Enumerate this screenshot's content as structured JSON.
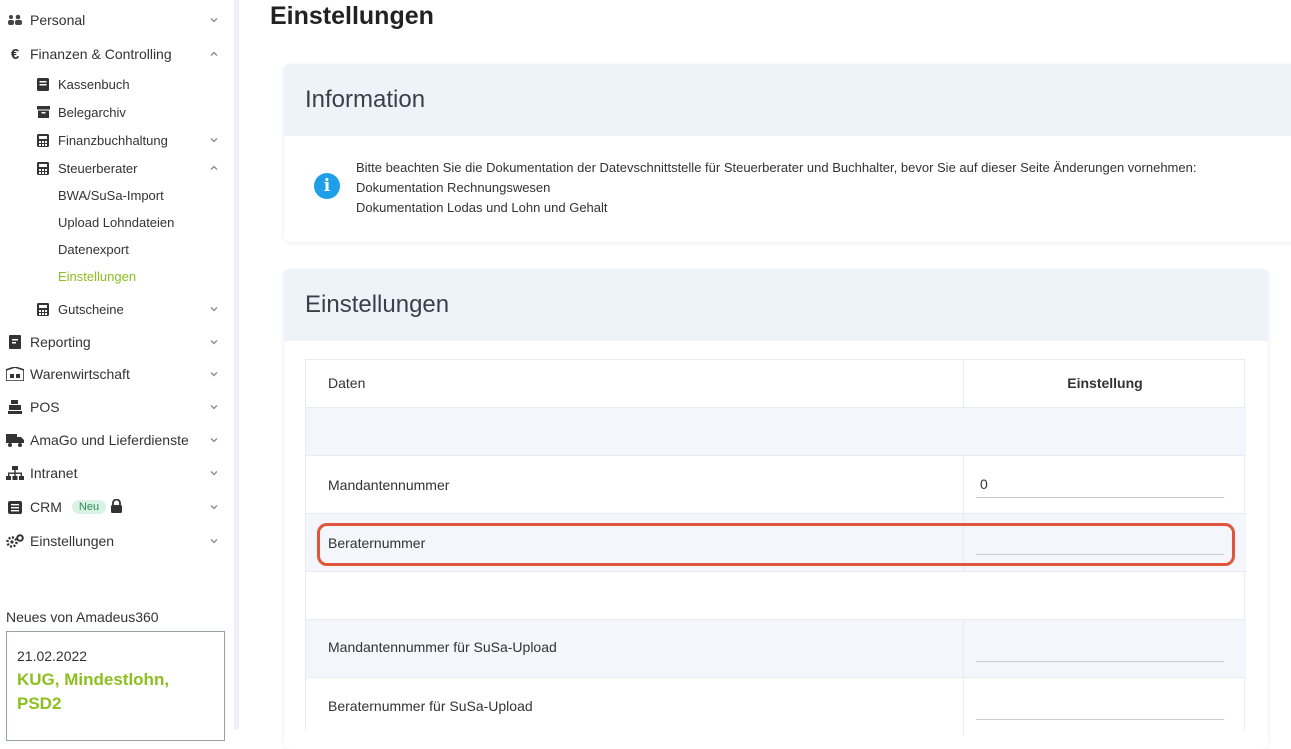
{
  "sidebar": {
    "personal": "Personal",
    "finanzen": "Finanzen & Controlling",
    "kassenbuch": "Kassenbuch",
    "belegarchiv": "Belegarchiv",
    "finanzbuchhaltung": "Finanzbuchhaltung",
    "steuerberater": "Steuerberater",
    "bwa": "BWA/SuSa-Import",
    "upload": "Upload Lohndateien",
    "datenexport": "Datenexport",
    "einstellungen_sub": "Einstellungen",
    "gutscheine": "Gutscheine",
    "reporting": "Reporting",
    "warenwirtschaft": "Warenwirtschaft",
    "pos": "POS",
    "amago": "AmaGo und Lieferdienste",
    "intranet": "Intranet",
    "crm": "CRM",
    "crm_badge": "Neu",
    "einstellungen": "Einstellungen"
  },
  "news": {
    "title": "Neues von Amadeus360",
    "date": "21.02.2022",
    "headline": "KUG, Mindestlohn, PSD2"
  },
  "main": {
    "page_title": "Einstellungen",
    "info_title": "Information",
    "info_text": "Bitte beachten Sie die Dokumentation der Datevschnittstelle für Steuerberater und Buchhalter, bevor Sie auf dieser Seite Änderungen vornehmen:",
    "info_link1": "Dokumentation Rechnungswesen",
    "info_link2": "Dokumentation Lodas und Lohn und Gehalt",
    "settings_title": "Einstellungen",
    "col_daten": "Daten",
    "col_einstellung": "Einstellung",
    "rows": {
      "mandant": "Mandantennummer",
      "mandant_value": "0",
      "berater": "Beraternummer",
      "berater_value": "",
      "mandant_susa": "Mandantennummer für SuSa-Upload",
      "mandant_susa_value": "",
      "berater_susa": "Beraternummer für SuSa-Upload",
      "berater_susa_value": ""
    }
  },
  "colors": {
    "accent_green": "#8dbf1f",
    "info_blue": "#1e9fe8",
    "highlight_red": "#e0553b"
  }
}
